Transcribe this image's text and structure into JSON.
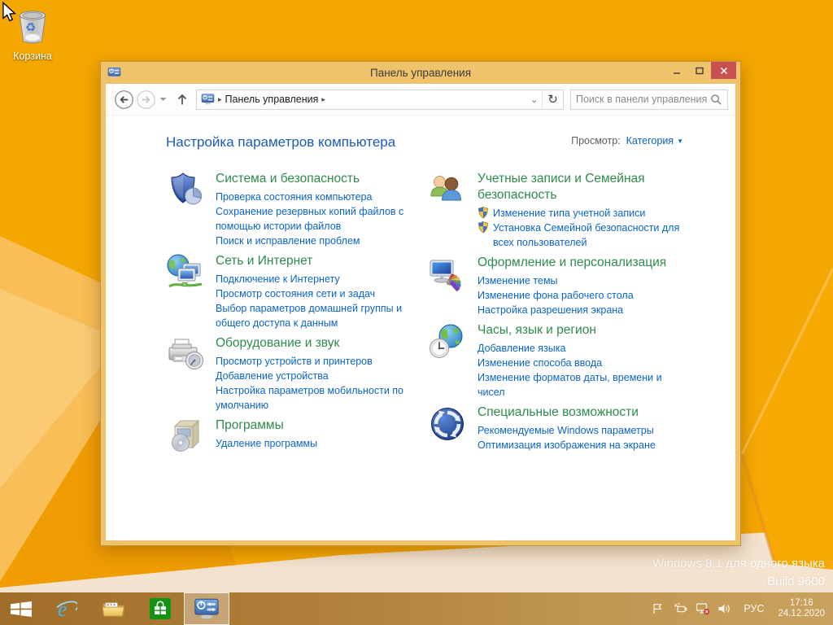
{
  "desktop": {
    "recycle_bin_label": "Корзина",
    "watermark": {
      "line1": "Windows 8.1 для одного языка",
      "line2": "Build 9600"
    }
  },
  "window": {
    "title": "Панель управления",
    "toolbar": {
      "breadcrumb_root": "Панель управления",
      "search_placeholder": "Поиск в панели управления"
    },
    "header": {
      "title": "Настройка параметров компьютера",
      "view_label": "Просмотр:",
      "view_value": "Категория"
    }
  },
  "categories": {
    "left": [
      {
        "title": "Система и безопасность",
        "icon": "system-security",
        "links": [
          {
            "text": "Проверка состояния компьютера"
          },
          {
            "text": "Сохранение резервных копий файлов с помощью истории файлов"
          },
          {
            "text": "Поиск и исправление проблем"
          }
        ]
      },
      {
        "title": "Сеть и Интернет",
        "icon": "network-internet",
        "links": [
          {
            "text": "Подключение к Интернету"
          },
          {
            "text": "Просмотр состояния сети и задач"
          },
          {
            "text": "Выбор параметров домашней группы и общего доступа к данным"
          }
        ]
      },
      {
        "title": "Оборудование и звук",
        "icon": "hardware-sound",
        "links": [
          {
            "text": "Просмотр устройств и принтеров"
          },
          {
            "text": "Добавление устройства"
          },
          {
            "text": "Настройка параметров мобильности по умолчанию"
          }
        ]
      },
      {
        "title": "Программы",
        "icon": "programs",
        "links": [
          {
            "text": "Удаление программы"
          }
        ]
      }
    ],
    "right": [
      {
        "title": "Учетные записи и Семейная безопасность",
        "icon": "user-accounts",
        "links": [
          {
            "text": "Изменение типа учетной записи",
            "shield": true
          },
          {
            "text": "Установка Семейной безопасности для всех пользователей",
            "shield": true
          }
        ]
      },
      {
        "title": "Оформление и персонализация",
        "icon": "appearance",
        "links": [
          {
            "text": "Изменение темы"
          },
          {
            "text": "Изменение фона рабочего стола"
          },
          {
            "text": "Настройка разрешения экрана"
          }
        ]
      },
      {
        "title": "Часы, язык и регион",
        "icon": "clock-region",
        "links": [
          {
            "text": "Добавление языка"
          },
          {
            "text": "Изменение способа ввода"
          },
          {
            "text": "Изменение форматов даты, времени и чисел"
          }
        ]
      },
      {
        "title": "Специальные возможности",
        "icon": "ease-of-access",
        "links": [
          {
            "text": "Рекомендуемые Windows параметры"
          },
          {
            "text": "Оптимизация изображения на экране"
          }
        ]
      }
    ]
  },
  "taskbar": {
    "apps": [
      {
        "id": "start"
      },
      {
        "id": "internet-explorer"
      },
      {
        "id": "file-explorer"
      },
      {
        "id": "store"
      },
      {
        "id": "control-panel",
        "active": true
      }
    ],
    "tray": {
      "lang": "РУС",
      "time": "17:16",
      "date": "24.12.2020"
    }
  },
  "colors": {
    "desktop_orange": "#f5a701",
    "window_frame_gold": "#efc26c",
    "close_red": "#c75050",
    "category_green": "#2e8b4a",
    "link_blue": "#0a64c8",
    "header_blue": "#1c5bb8",
    "taskbar_brown": "#a5722c",
    "store_green": "#129312"
  }
}
